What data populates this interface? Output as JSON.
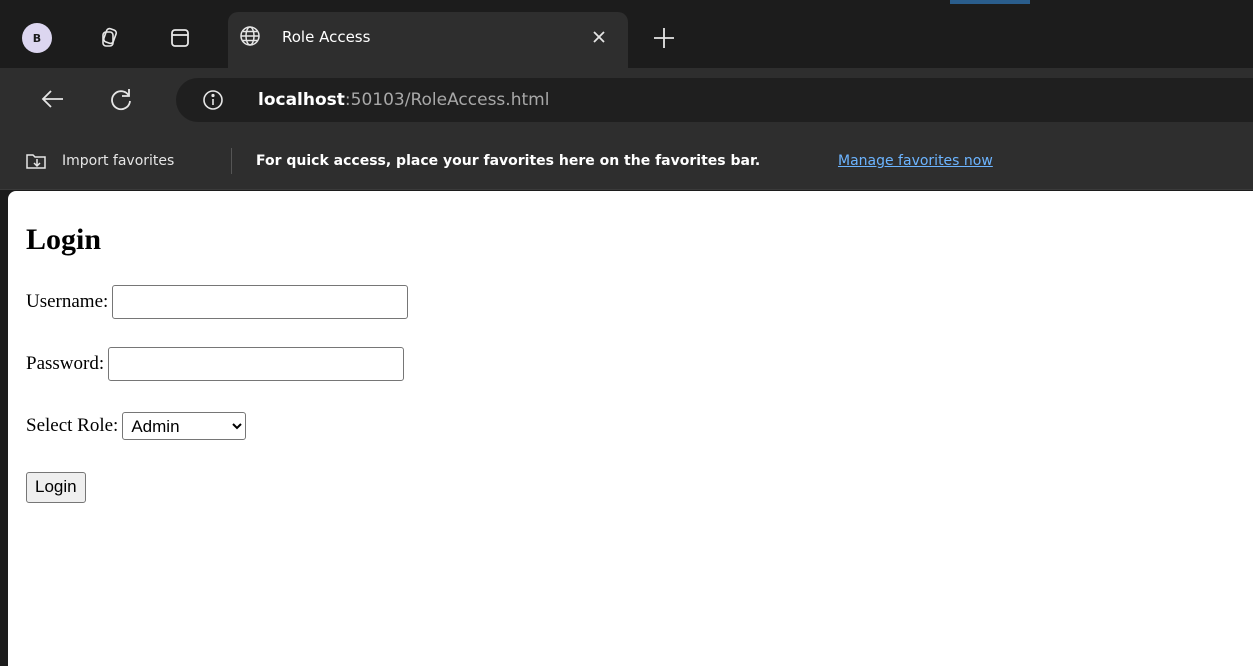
{
  "browser": {
    "profile_initial": "B",
    "tab": {
      "title": "Role Access"
    },
    "address": {
      "host": "localhost",
      "rest": ":50103/RoleAccess.html"
    },
    "favorites": {
      "import_label": "Import favorites",
      "hint": "For quick access, place your favorites here on the favorites bar.",
      "manage_link": "Manage favorites now"
    },
    "icons": {
      "workspaces": "workspaces-icon",
      "tab_actions": "tab-actions-icon",
      "globe": "globe-icon",
      "close": "close-icon",
      "new_tab": "plus-icon",
      "back": "back-arrow-icon",
      "refresh": "refresh-icon",
      "info": "info-icon",
      "import": "import-favorites-icon"
    }
  },
  "page": {
    "heading": "Login",
    "username": {
      "label": "Username:",
      "value": ""
    },
    "password": {
      "label": "Password:",
      "value": ""
    },
    "role": {
      "label": "Select Role:",
      "selected": "Admin"
    },
    "login_button": "Login"
  }
}
